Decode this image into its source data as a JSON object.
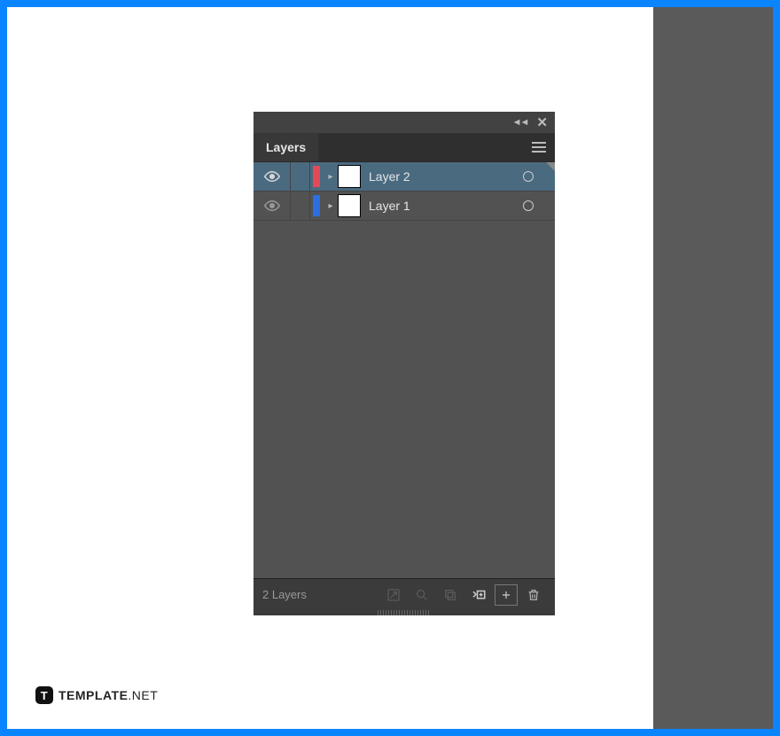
{
  "panel": {
    "tab_label": "Layers",
    "footer_count": "2 Layers"
  },
  "layers": [
    {
      "name": "Layer 2",
      "color": "#e24a5a",
      "selected": true
    },
    {
      "name": "Layer 1",
      "color": "#2b6fe0",
      "selected": false
    }
  ],
  "watermark": {
    "badge": "T",
    "bold": "TEMPLATE",
    "light": ".NET"
  }
}
